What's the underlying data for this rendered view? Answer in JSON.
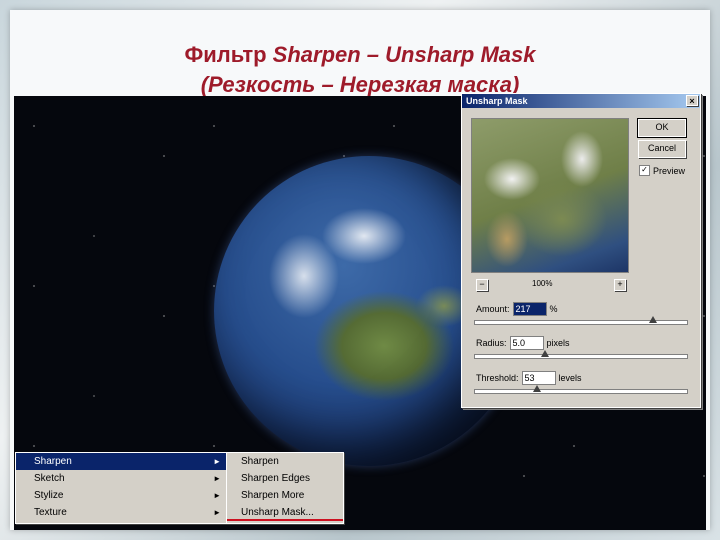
{
  "slide": {
    "title_prefix": "Фильтр ",
    "title_emph": "Sharpen – Unsharp Mask",
    "title_line2": "(Резкость – Нерезкая маска)"
  },
  "dialog": {
    "title": "Unsharp Mask",
    "close_glyph": "×",
    "zoom_minus": "−",
    "zoom_plus": "+",
    "zoom_level": "100%",
    "ok_label": "OK",
    "cancel_label": "Cancel",
    "preview_label": "Preview",
    "preview_checked": "✓",
    "amount_label": "Amount:",
    "amount_value": "217",
    "amount_unit": "%",
    "radius_label": "Radius:",
    "radius_value": "5.0",
    "radius_unit": "pixels",
    "threshold_label": "Threshold:",
    "threshold_value": "53",
    "threshold_unit": "levels"
  },
  "menu": {
    "items": [
      "Sharpen",
      "Sketch",
      "Stylize",
      "Texture"
    ],
    "arrow_glyph": "►",
    "submenu": [
      "Sharpen",
      "Sharpen Edges",
      "Sharpen More",
      "Unsharp Mask..."
    ]
  }
}
